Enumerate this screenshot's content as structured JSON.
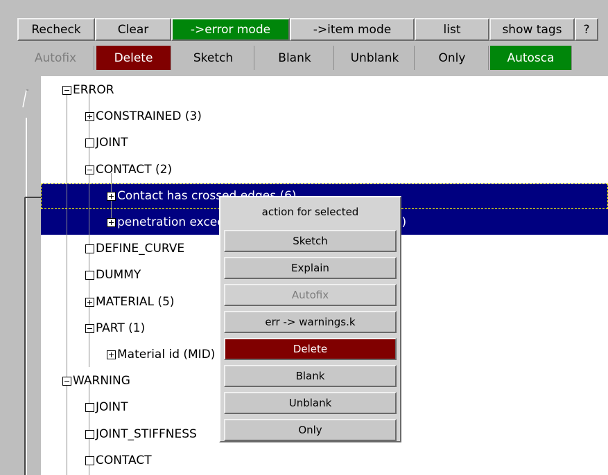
{
  "toolbar_row1": [
    {
      "name": "recheck-button",
      "label": "Recheck",
      "style": "normal"
    },
    {
      "name": "clear-button",
      "label": "Clear",
      "style": "normal"
    },
    {
      "name": "error-mode-button",
      "label": "->error mode",
      "style": "green"
    },
    {
      "name": "item-mode-button",
      "label": "->item mode",
      "style": "normal"
    },
    {
      "name": "list-button",
      "label": "list",
      "style": "normal"
    },
    {
      "name": "show-tags-button",
      "label": "show tags",
      "style": "normal"
    },
    {
      "name": "help-button",
      "label": "?",
      "style": "normal"
    }
  ],
  "toolbar_row2": [
    {
      "name": "autofix-button",
      "label": "Autofix",
      "style": "disabled"
    },
    {
      "name": "delete-button",
      "label": "Delete",
      "style": "red"
    },
    {
      "name": "sketch-button",
      "label": "Sketch",
      "style": "normal"
    },
    {
      "name": "blank-button",
      "label": "Blank",
      "style": "normal"
    },
    {
      "name": "unblank-button",
      "label": "Unblank",
      "style": "normal"
    },
    {
      "name": "only-button",
      "label": "Only",
      "style": "normal"
    },
    {
      "name": "autoscale-button",
      "label": "Autosca",
      "style": "green"
    }
  ],
  "tree": [
    {
      "label": "ERROR",
      "level": 0,
      "expander": "minus",
      "selected": false
    },
    {
      "label": "CONSTRAINED (3)",
      "level": 1,
      "expander": "plus",
      "selected": false
    },
    {
      "label": "JOINT",
      "level": 1,
      "expander": "none",
      "selected": false
    },
    {
      "label": "CONTACT (2)",
      "level": 1,
      "expander": "minus",
      "selected": false
    },
    {
      "label": "Contact has crossed edges (6)",
      "level": 2,
      "expander": "plus",
      "selected": true
    },
    {
      "label": "penetration exceeds 40% of thickness value (10)",
      "level": 2,
      "expander": "plus",
      "selected": true
    },
    {
      "label": "DEFINE_CURVE",
      "level": 1,
      "expander": "none",
      "selected": false
    },
    {
      "label": "DUMMY",
      "level": 1,
      "expander": "none",
      "selected": false
    },
    {
      "label": "MATERIAL (5)",
      "level": 1,
      "expander": "plus",
      "selected": false
    },
    {
      "label": "PART (1)",
      "level": 1,
      "expander": "minus",
      "selected": false
    },
    {
      "label": "Material id (MID) is not defined (1)",
      "level": 2,
      "expander": "plus",
      "selected": false
    },
    {
      "label": "WARNING",
      "level": 0,
      "expander": "minus",
      "selected": false
    },
    {
      "label": "JOINT",
      "level": 1,
      "expander": "none",
      "selected": false
    },
    {
      "label": "JOINT_STIFFNESS",
      "level": 1,
      "expander": "none",
      "selected": false
    },
    {
      "label": "CONTACT",
      "level": 1,
      "expander": "none",
      "selected": false
    }
  ],
  "context_menu": {
    "title": "action for selected",
    "items": [
      {
        "name": "menu-sketch",
        "label": "Sketch",
        "style": "normal"
      },
      {
        "name": "menu-explain",
        "label": "Explain",
        "style": "normal"
      },
      {
        "name": "menu-autofix",
        "label": "Autofix",
        "style": "disabled"
      },
      {
        "name": "menu-err-to-warnings",
        "label": "err -> warnings.k",
        "style": "normal"
      },
      {
        "name": "menu-delete",
        "label": "Delete",
        "style": "red"
      },
      {
        "name": "menu-blank",
        "label": "Blank",
        "style": "normal"
      },
      {
        "name": "menu-unblank",
        "label": "Unblank",
        "style": "normal"
      },
      {
        "name": "menu-only",
        "label": "Only",
        "style": "normal"
      }
    ]
  },
  "colors": {
    "green": "#00860a",
    "red": "#800000",
    "selection": "#000080",
    "panel": "#bebebe"
  }
}
